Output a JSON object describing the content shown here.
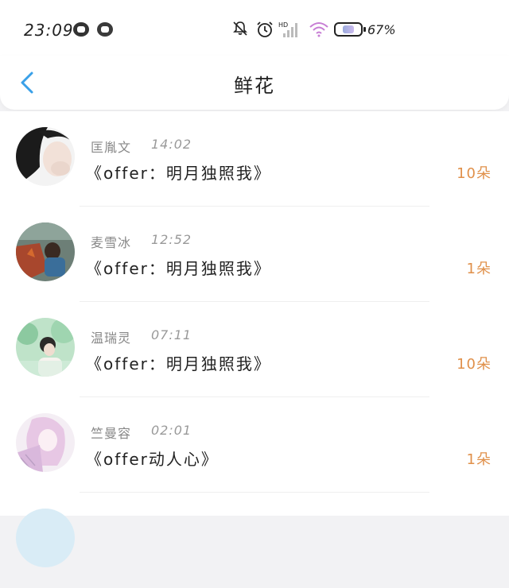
{
  "status_bar": {
    "time": "23:09",
    "network": "HD",
    "battery_percent": "67%",
    "icons": [
      "app-a-icon",
      "app-b-icon",
      "bell-muted-icon",
      "alarm-icon",
      "signal-icon",
      "wifi-icon",
      "battery-icon"
    ]
  },
  "header": {
    "title": "鲜花",
    "back_icon": "chevron-left-icon",
    "accent": "#3aa0e8"
  },
  "rows": [
    {
      "name": "匡胤文",
      "time": "14:02",
      "book": "《offer：明月独照我》",
      "count": "10朵"
    },
    {
      "name": "麦雪冰",
      "time": "12:52",
      "book": "《offer：明月独照我》",
      "count": "1朵"
    },
    {
      "name": "温瑞灵",
      "time": "07:11",
      "book": "《offer：明月独照我》",
      "count": "10朵"
    },
    {
      "name": "竺曼容",
      "time": "02:01",
      "book": "《offer动人心》",
      "count": "1朵"
    }
  ],
  "colors": {
    "count": "#e0904a",
    "name": "#888888"
  }
}
